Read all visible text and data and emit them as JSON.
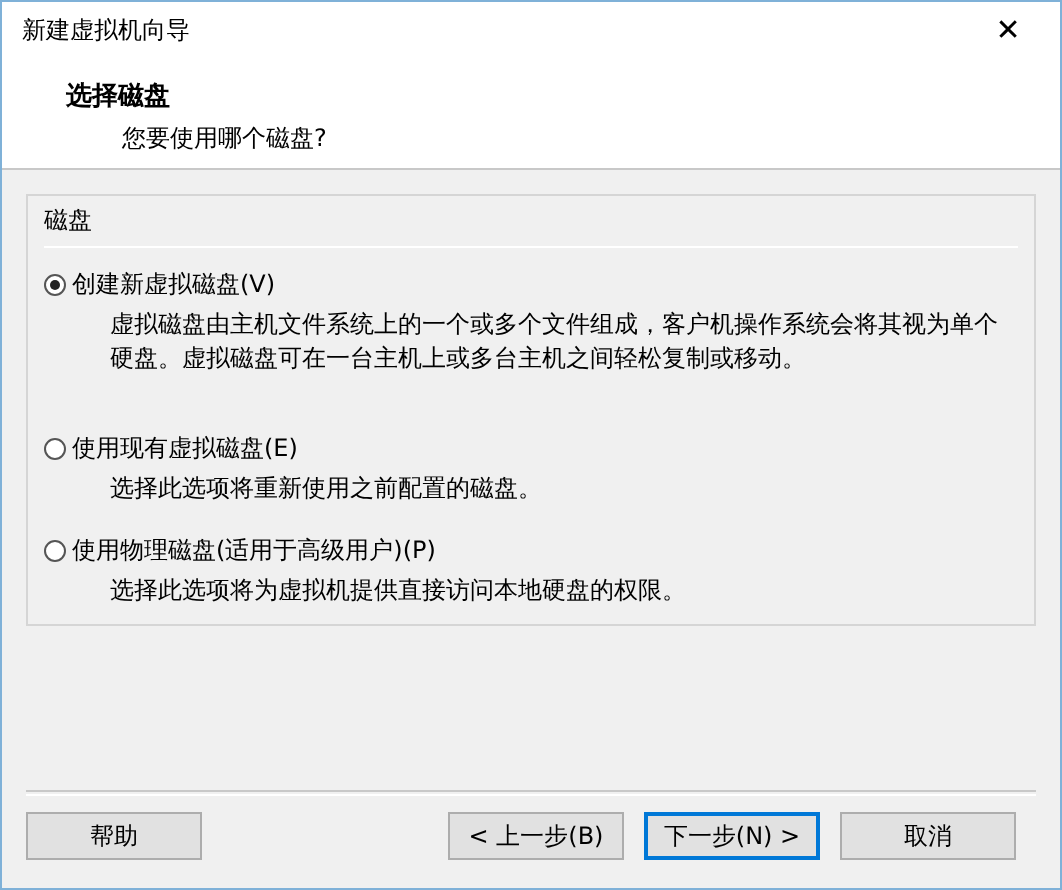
{
  "window": {
    "title": "新建虚拟机向导",
    "close": "✕"
  },
  "header": {
    "title": "选择磁盘",
    "subtitle": "您要使用哪个磁盘?"
  },
  "group": {
    "label": "磁盘",
    "options": [
      {
        "label": "创建新虚拟磁盘(V)",
        "description": "虚拟磁盘由主机文件系统上的一个或多个文件组成，客户机操作系统会将其视为单个硬盘。虚拟磁盘可在一台主机上或多台主机之间轻松复制或移动。",
        "selected": true
      },
      {
        "label": "使用现有虚拟磁盘(E)",
        "description": "选择此选项将重新使用之前配置的磁盘。",
        "selected": false
      },
      {
        "label": "使用物理磁盘(适用于高级用户)(P)",
        "description": "选择此选项将为虚拟机提供直接访问本地硬盘的权限。",
        "selected": false
      }
    ]
  },
  "buttons": [
    {
      "label": "帮助",
      "focused": false
    },
    {
      "label": "< 上一步(B)",
      "focused": false
    },
    {
      "label": "下一步(N) >",
      "focused": true
    },
    {
      "label": "取消",
      "focused": false
    }
  ]
}
